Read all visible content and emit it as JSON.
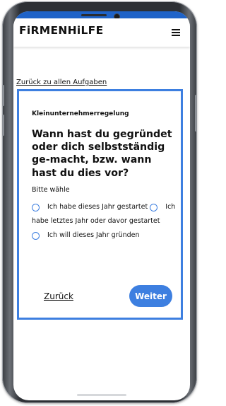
{
  "header": {
    "logo_text": "FiRMENHiLFE"
  },
  "nav": {
    "back_to_tasks": "Zurück zu allen Aufgaben"
  },
  "card": {
    "kicker": "Kleinunternehmerregelung",
    "question": "Wann hast du gegründet oder dich selbstständig ge-macht, bzw. wann hast du dies vor?",
    "hint": "Bitte wähle",
    "options": [
      {
        "label": "Ich habe dieses Jahr gestartet",
        "selected": false
      },
      {
        "label": "Ich habe letztes Jahr oder davor gestartet",
        "selected": false
      },
      {
        "label": "Ich will dieses Jahr gründen",
        "selected": false
      }
    ],
    "back_label": "Zurück",
    "next_label": "Weiter"
  },
  "colors": {
    "accent": "#3d7fe0",
    "status_bar": "#1f63c8"
  },
  "icons": [
    "hamburger-menu-icon",
    "radio-unchecked-icon"
  ]
}
